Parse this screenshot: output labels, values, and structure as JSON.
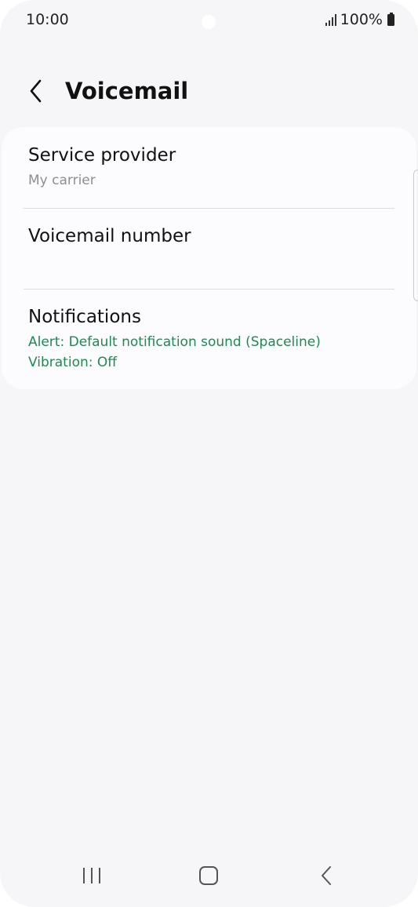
{
  "status_bar": {
    "time": "10:00",
    "battery_text": "100%"
  },
  "header": {
    "title": "Voicemail"
  },
  "settings": {
    "service_provider": {
      "title": "Service provider",
      "subtitle": "My carrier"
    },
    "voicemail_number": {
      "title": "Voicemail number"
    },
    "notifications": {
      "title": "Notifications",
      "alert": "Alert: Default notification sound (Spaceline)",
      "vibration": "Vibration: Off"
    }
  },
  "colors": {
    "background": "#f6f6f8",
    "card": "#fcfcfe",
    "accent_green": "#1f8a4e",
    "secondary_text": "#8d8d93"
  },
  "icons": {
    "back": "chevron-left-icon",
    "recents": "recent-apps-icon",
    "home": "home-icon",
    "nav_back": "nav-back-icon"
  }
}
